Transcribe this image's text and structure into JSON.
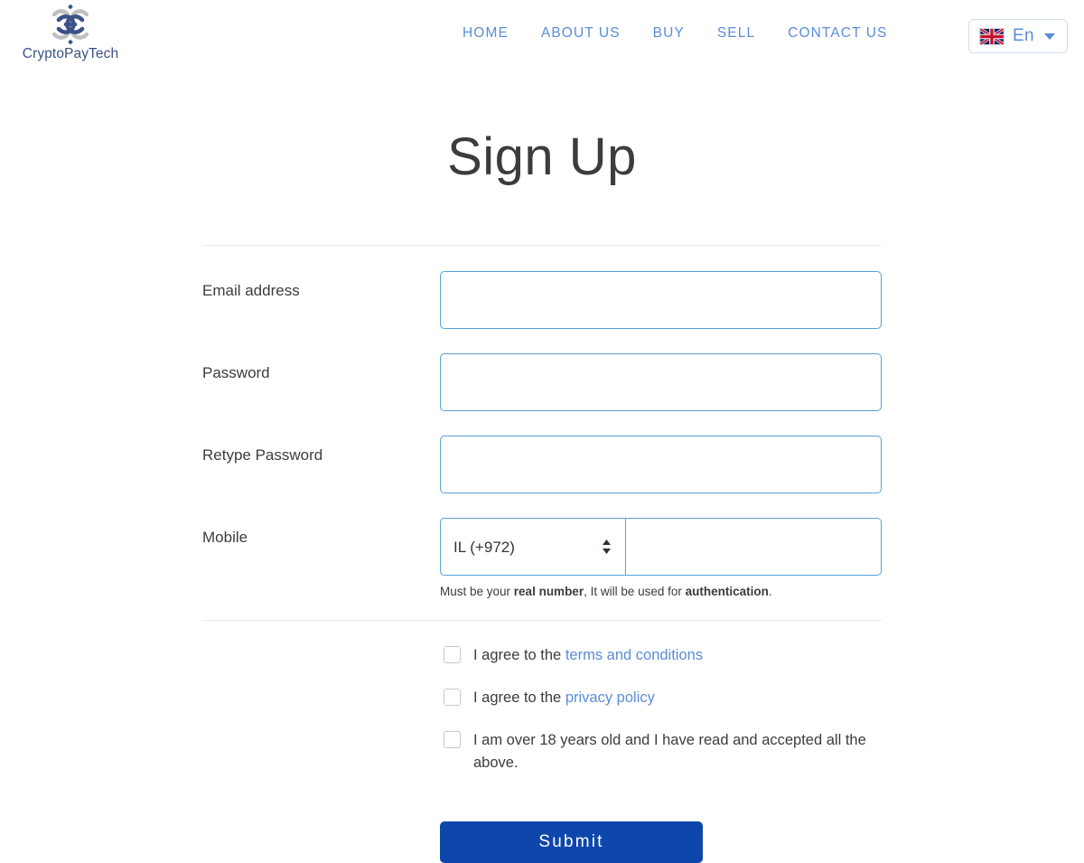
{
  "header": {
    "brand": {
      "name": "CryptoPayTech",
      "logo_icon": "interlocking-knot-logo",
      "logo_color_primary": "#3b5387",
      "logo_color_secondary": "#bfbfbf"
    },
    "nav": [
      {
        "label": "HOME"
      },
      {
        "label": "ABOUT US"
      },
      {
        "label": "BUY"
      },
      {
        "label": "SELL"
      },
      {
        "label": "CONTACT US"
      }
    ],
    "nav_color": "#5b8dd6",
    "language": {
      "flag_icon": "uk-flag-icon",
      "label": "En",
      "caret_icon": "chevron-down-icon"
    }
  },
  "main": {
    "title": "Sign Up",
    "fields": [
      {
        "label": "Email address",
        "value": "",
        "placeholder": ""
      },
      {
        "label": "Password",
        "value": "",
        "placeholder": ""
      },
      {
        "label": "Retype Password",
        "value": "",
        "placeholder": ""
      }
    ],
    "mobile": {
      "label": "Mobile",
      "country_selected": "IL (+972)",
      "country_options": [
        "IL (+972)"
      ],
      "number_value": "",
      "number_placeholder": "",
      "stepper_icon": "up-down-stepper-icon",
      "help_prefix": "Must be your ",
      "help_bold_1": "real number",
      "help_middle": ", It will be used for ",
      "help_bold_2": "authentication",
      "help_suffix": "."
    },
    "consents": [
      {
        "text_before": "I agree to the ",
        "link_text": "terms and conditions",
        "text_after": "",
        "checked": false
      },
      {
        "text_before": "I agree to the ",
        "link_text": "privacy policy",
        "text_after": "",
        "checked": false
      },
      {
        "text_before": "I am over 18 years old and I have read and accepted all the above.",
        "link_text": "",
        "text_after": "",
        "checked": false
      }
    ],
    "submit_label": "Submit",
    "submit_color": "#0e47ab"
  }
}
